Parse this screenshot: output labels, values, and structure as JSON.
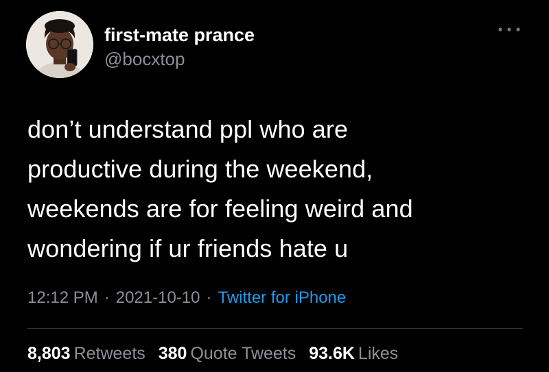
{
  "author": {
    "display_name": "first-mate prance",
    "handle": "@bocxtop",
    "avatar_icon": "profile-photo"
  },
  "more_icon": "ellipsis-icon",
  "tweet": {
    "lines": [
      "don’t understand ppl who are",
      "productive during the weekend,",
      "weekends are for feeling weird and",
      "wondering if ur friends hate u"
    ]
  },
  "meta": {
    "time": "12:12 PM",
    "separator": "·",
    "date": "2021-10-10",
    "source": "Twitter for iPhone"
  },
  "stats": {
    "retweets": {
      "count": "8,803",
      "label": "Retweets"
    },
    "quote_tweets": {
      "count": "380",
      "label": "Quote Tweets"
    },
    "likes": {
      "count": "93.6K",
      "label": "Likes"
    }
  },
  "colors": {
    "background": "#000000",
    "text": "#ffffff",
    "secondary_text": "#8b9096",
    "link": "#1d9bf0",
    "divider": "#2f3336"
  }
}
